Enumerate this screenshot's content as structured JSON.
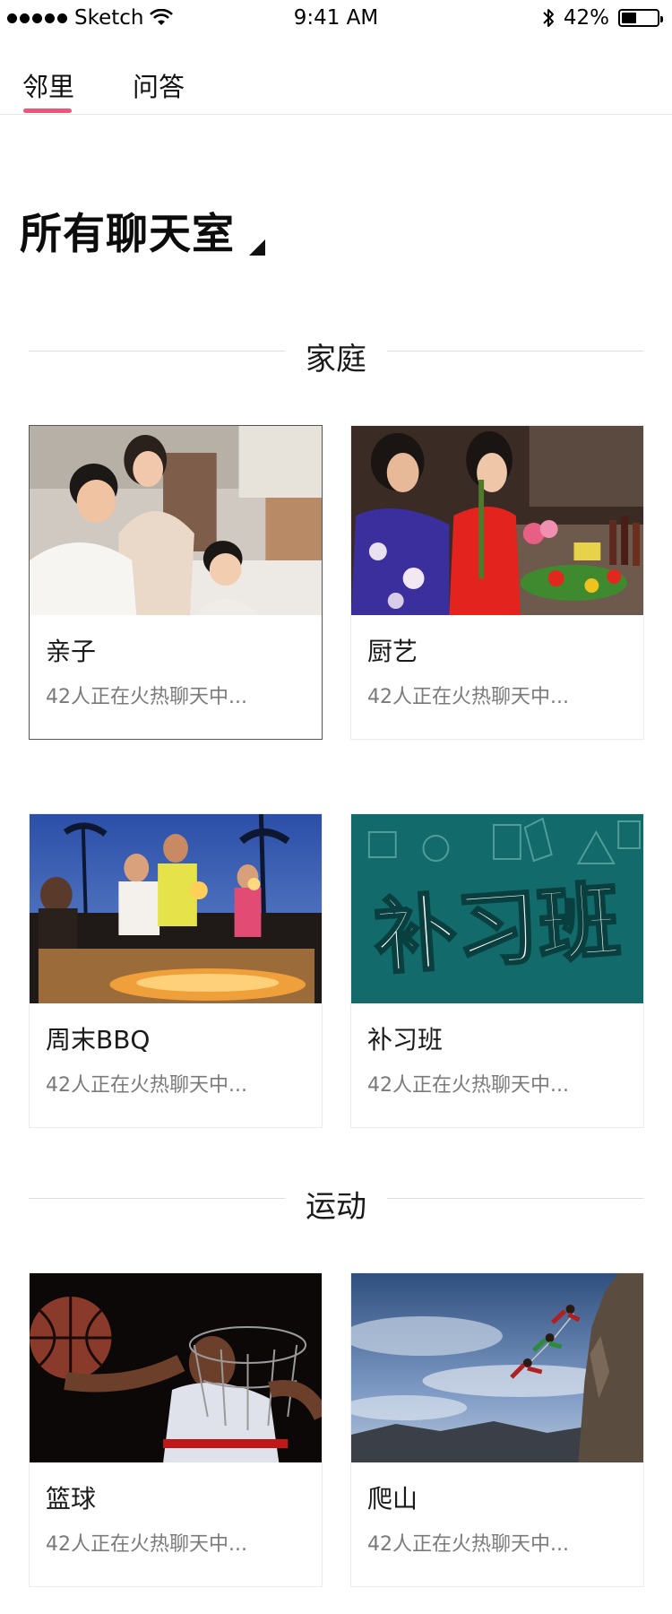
{
  "status_bar": {
    "carrier": "Sketch",
    "time": "9:41 AM",
    "battery_percent_text": "42%",
    "battery_level": 0.42
  },
  "tabs": [
    {
      "label": "邻里",
      "active": true
    },
    {
      "label": "问答",
      "active": false
    }
  ],
  "heading": {
    "title": "所有聊天室"
  },
  "categories": [
    {
      "title": "家庭",
      "rooms": [
        {
          "title": "亲子",
          "subtitle": "42人正在火热聊天中...",
          "image": "family-photo"
        },
        {
          "title": "厨艺",
          "subtitle": "42人正在火热聊天中...",
          "image": "cooking-photo"
        },
        {
          "title": "周末BBQ",
          "subtitle": "42人正在火热聊天中...",
          "image": "bbq-photo"
        },
        {
          "title": "补习班",
          "subtitle": "42人正在火热聊天中...",
          "image": "tutoring-poster",
          "image_text": "补习班"
        }
      ]
    },
    {
      "title": "运动",
      "rooms": [
        {
          "title": "篮球",
          "subtitle": "42人正在火热聊天中...",
          "image": "basketball-photo"
        },
        {
          "title": "爬山",
          "subtitle": "42人正在火热聊天中...",
          "image": "climbing-photo"
        }
      ]
    }
  ],
  "colors": {
    "accent": "#e9587a",
    "divider": "#dddddd",
    "subtitle": "#7a7a7a"
  }
}
